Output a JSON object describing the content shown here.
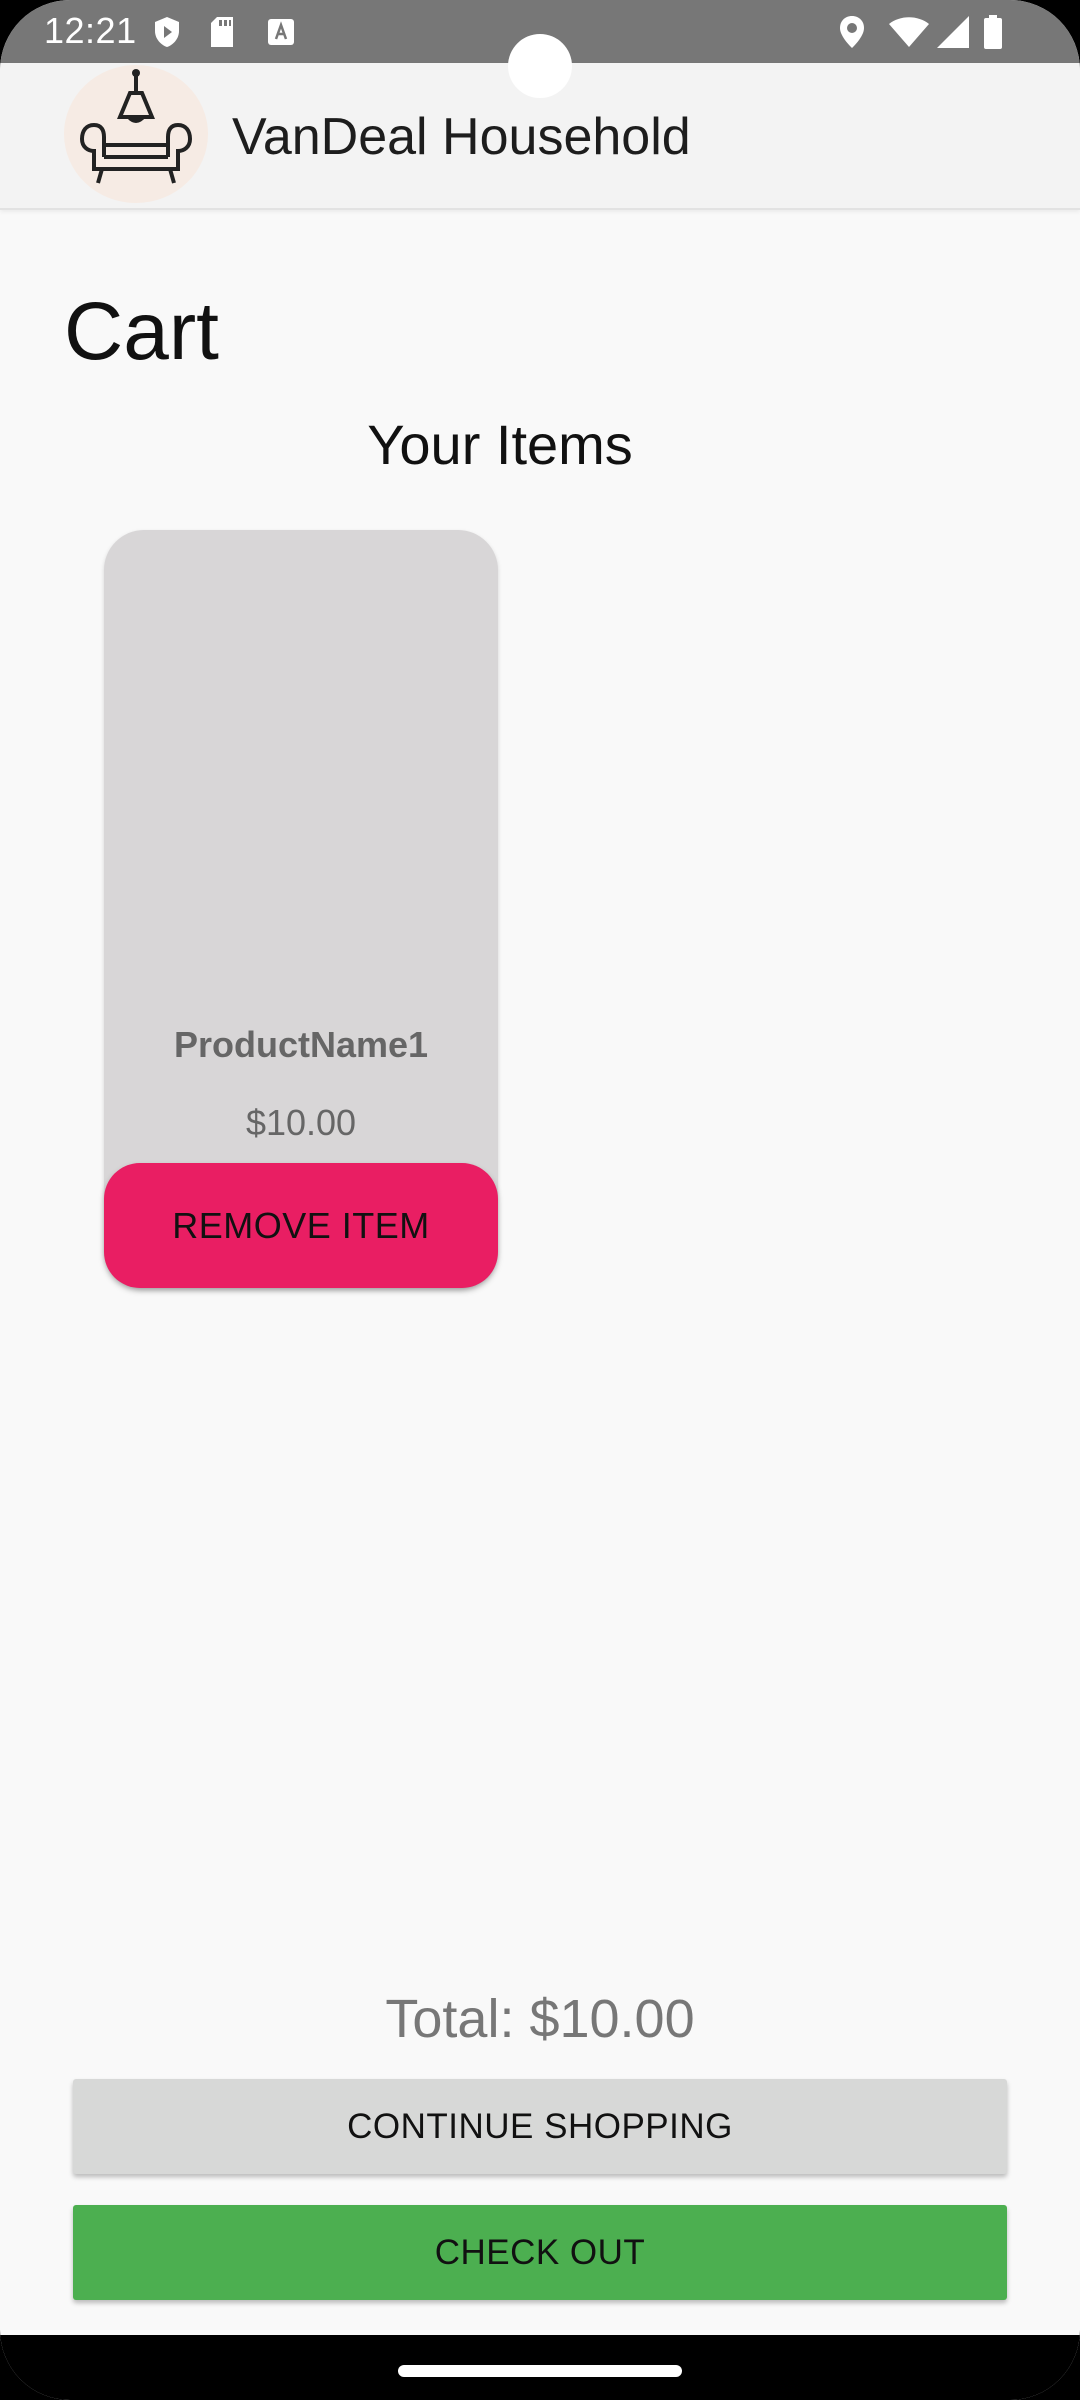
{
  "status_bar": {
    "time": "12:21",
    "left_icons": [
      "shield-icon",
      "sd-card-icon",
      "keyboard-a-icon"
    ],
    "right_icons": [
      "location-icon",
      "wifi-icon",
      "signal-icon",
      "battery-icon"
    ]
  },
  "app_bar": {
    "title": "VanDeal Household",
    "logo": "furniture-lamp-logo"
  },
  "page": {
    "title": "Cart",
    "section_title": "Your Items"
  },
  "cart": {
    "items": [
      {
        "name": "ProductName1",
        "price": "$10.00",
        "remove_label": "REMOVE ITEM"
      }
    ],
    "total": "Total: $10.00"
  },
  "actions": {
    "continue_label": "CONTINUE SHOPPING",
    "checkout_label": "CHECK OUT"
  },
  "colors": {
    "status_bar": "#777777",
    "remove_button": "#e91e63",
    "checkout_button": "#4caf50",
    "continue_button": "#d7d8d7"
  }
}
